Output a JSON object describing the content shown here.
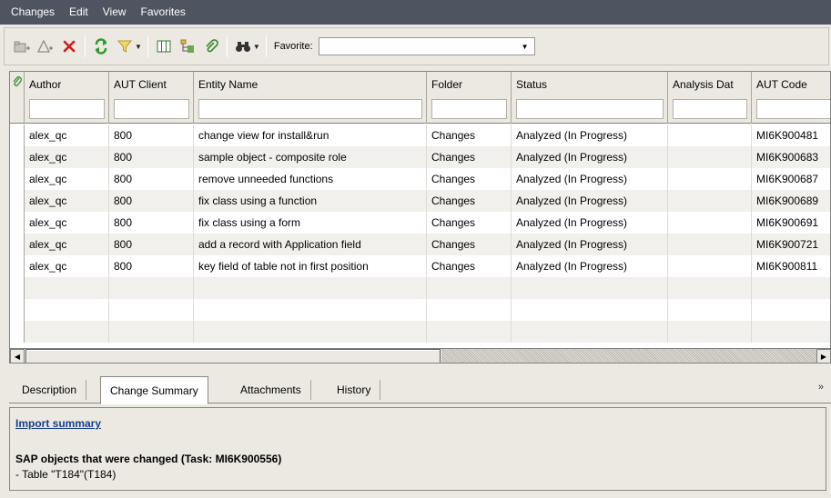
{
  "menu": [
    "Changes",
    "Edit",
    "View",
    "Favorites"
  ],
  "toolbar": {
    "favorite_label": "Favorite:",
    "favorite_value": ""
  },
  "grid": {
    "columns": [
      "Author",
      "AUT Client",
      "Entity Name",
      "Folder",
      "Status",
      "Analysis Dat",
      "AUT Code"
    ],
    "rows": [
      [
        "alex_qc",
        "800",
        "change view for install&run",
        "Changes",
        "Analyzed (In Progress)",
        "",
        "MI6K900481"
      ],
      [
        "alex_qc",
        "800",
        "sample object - composite role",
        "Changes",
        "Analyzed (In Progress)",
        "",
        "MI6K900683"
      ],
      [
        "alex_qc",
        "800",
        "remove unneeded functions",
        "Changes",
        "Analyzed (In Progress)",
        "",
        "MI6K900687"
      ],
      [
        "alex_qc",
        "800",
        "fix class using a function",
        "Changes",
        "Analyzed (In Progress)",
        "",
        "MI6K900689"
      ],
      [
        "alex_qc",
        "800",
        "fix class using a form",
        "Changes",
        "Analyzed (In Progress)",
        "",
        "MI6K900691"
      ],
      [
        "alex_qc",
        "800",
        "add a record with Application field",
        "Changes",
        "Analyzed (In Progress)",
        "",
        "MI6K900721"
      ],
      [
        "alex_qc",
        "800",
        "key field of table not in first position",
        "Changes",
        "Analyzed (In Progress)",
        "",
        "MI6K900811"
      ]
    ]
  },
  "tabs": [
    "Description",
    "Change Summary",
    "Attachments",
    "History"
  ],
  "active_tab": "Change Summary",
  "panel": {
    "link": "Import summary",
    "heading": "SAP objects that were changed (Task: MI6K900556)",
    "line": " - Table \"T184\"(T184)"
  }
}
